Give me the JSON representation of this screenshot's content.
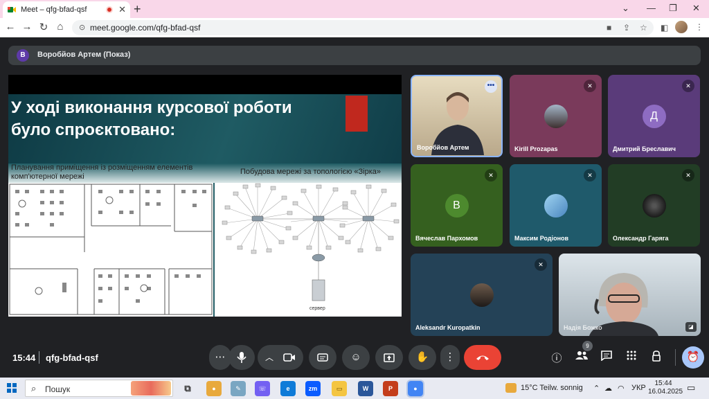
{
  "browser": {
    "tab_title": "Meet – qfg-bfad-qsf",
    "url": "meet.google.com/qfg-bfad-qsf"
  },
  "presenter": {
    "initial": "В",
    "label": "Воробйов Артем (Показ)"
  },
  "slide": {
    "title_line1": "У ході виконання курсової роботи",
    "title_line2": "було спроєктовано:",
    "sub_left": "Планування приміщення із розміщенням елементів комп'ютерної мережі",
    "sub_right": "Побудова мережі за топологією «Зірка»",
    "server_label": "сервер"
  },
  "participants": [
    {
      "name": "Воробйов Артем",
      "type": "video"
    },
    {
      "name": "Kirill Prozapas",
      "type": "photo"
    },
    {
      "name": "Дмитрий Бреславич",
      "initial": "Д"
    },
    {
      "name": "Вячеслав Пархомов",
      "initial": "В"
    },
    {
      "name": "Максим Родіонов",
      "type": "photo"
    },
    {
      "name": "Олександр Гаряга",
      "type": "photo"
    },
    {
      "name": "Aleksandr Kuropatkin",
      "type": "photo"
    },
    {
      "name": "Надія Божко",
      "type": "video"
    }
  ],
  "meeting": {
    "time": "15:44",
    "code": "qfg-bfad-qsf",
    "people_count": "9"
  },
  "taskbar": {
    "search_placeholder": "Пошук",
    "weather": "15°C  Teilw. sonnig",
    "language": "УКР",
    "time": "15:44",
    "date": "16.04.2025"
  },
  "colors": {
    "meet_bg": "#202124",
    "control_bg": "#3c4043",
    "end_call": "#ea4335",
    "tab_strip": "#f9d7e9"
  }
}
